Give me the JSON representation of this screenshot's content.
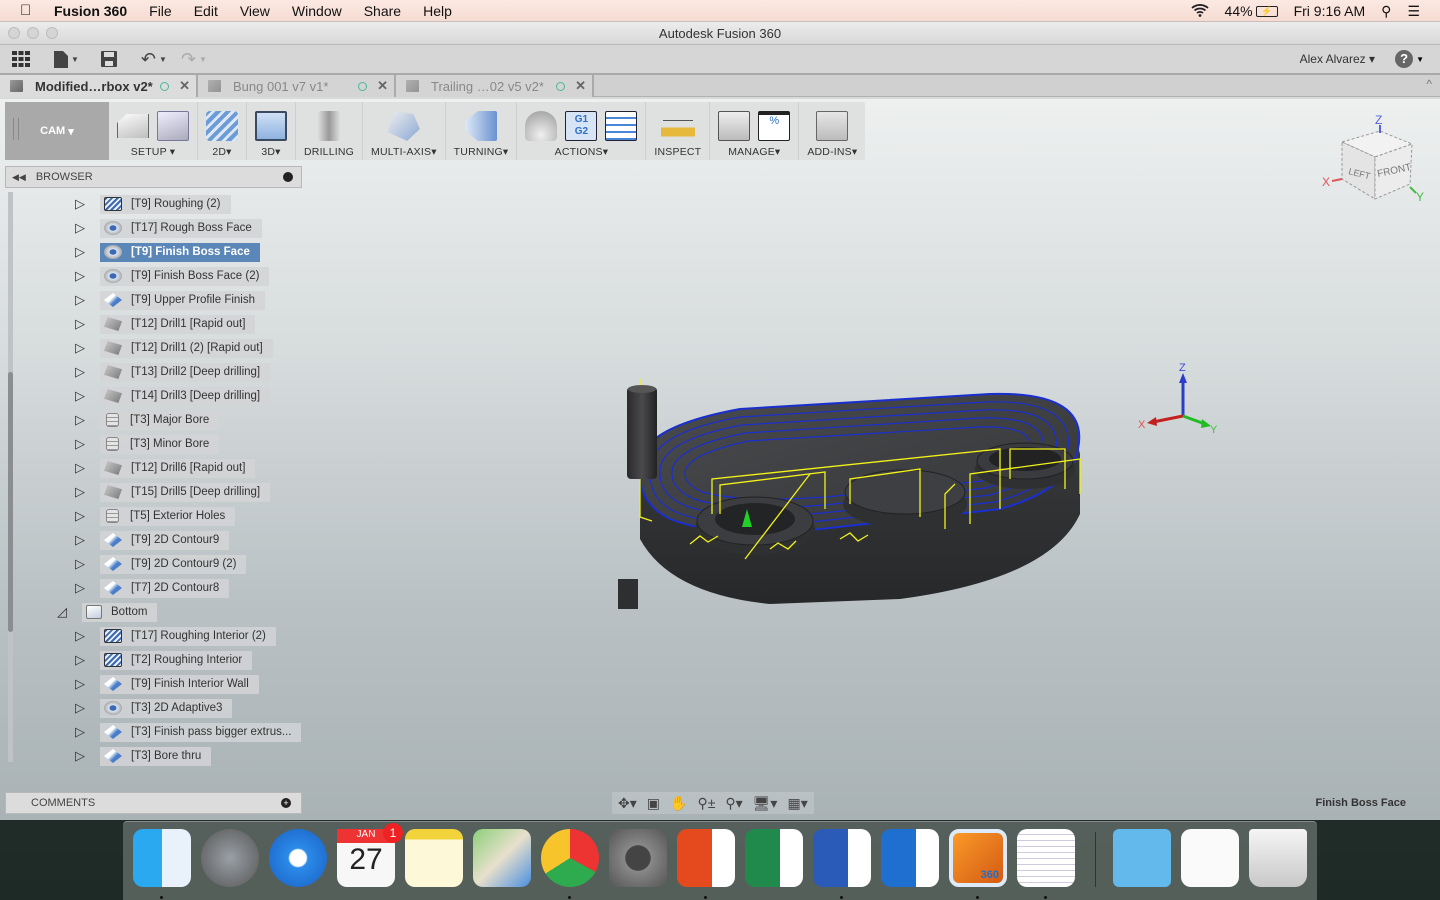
{
  "menubar": {
    "apple": "",
    "app": "Fusion 360",
    "items": [
      "File",
      "Edit",
      "View",
      "Window",
      "Share",
      "Help"
    ],
    "battery": "44%",
    "clock": "Fri 9:16 AM"
  },
  "window": {
    "title": "Autodesk Fusion 360"
  },
  "quick_access": {
    "user": "Alex Alvarez",
    "help": "?"
  },
  "doc_tabs": [
    {
      "name": "Modified…rbox v2*",
      "active": true
    },
    {
      "name": "Bung 001 v7 v1*",
      "active": false
    },
    {
      "name": "Trailing …02 v5 v2*",
      "active": false
    }
  ],
  "ribbon": {
    "workspace": "CAM",
    "groups": [
      {
        "label": "SETUP",
        "dropdown": true
      },
      {
        "label": "2D",
        "dropdown": true
      },
      {
        "label": "3D",
        "dropdown": true
      },
      {
        "label": "DRILLING",
        "dropdown": false
      },
      {
        "label": "MULTI-AXIS",
        "dropdown": true
      },
      {
        "label": "TURNING",
        "dropdown": true
      },
      {
        "label": "ACTIONS",
        "dropdown": true
      },
      {
        "label": "INSPECT",
        "dropdown": false
      },
      {
        "label": "MANAGE",
        "dropdown": true
      },
      {
        "label": "ADD-INS",
        "dropdown": true
      }
    ],
    "post_icon_text": "G1\nG2",
    "pct_icon_text": "%"
  },
  "browser": {
    "title": "BROWSER",
    "items": [
      {
        "label": "[T9] Roughing (2)",
        "icon": "rough"
      },
      {
        "label": "[T17] Rough Boss Face",
        "icon": "face"
      },
      {
        "label": "[T9] Finish Boss Face",
        "icon": "face",
        "selected": true
      },
      {
        "label": "[T9] Finish Boss Face (2)",
        "icon": "face"
      },
      {
        "label": "[T9] Upper Profile Finish",
        "icon": "contour"
      },
      {
        "label": "[T12] Drill1 [Rapid out]",
        "icon": "drill"
      },
      {
        "label": "[T12] Drill1 (2) [Rapid out]",
        "icon": "drill"
      },
      {
        "label": "[T13] Drill2 [Deep drilling]",
        "icon": "drill"
      },
      {
        "label": "[T14] Drill3 [Deep drilling]",
        "icon": "drill"
      },
      {
        "label": "[T3] Major Bore",
        "icon": "bore"
      },
      {
        "label": "[T3] Minor Bore",
        "icon": "bore"
      },
      {
        "label": "[T12] Drill6 [Rapid out]",
        "icon": "drill"
      },
      {
        "label": "[T15] Drill5 [Deep drilling]",
        "icon": "drill"
      },
      {
        "label": "[T5] Exterior Holes",
        "icon": "bore"
      },
      {
        "label": "[T9] 2D Contour9",
        "icon": "contour"
      },
      {
        "label": "[T9] 2D Contour9 (2)",
        "icon": "contour"
      },
      {
        "label": "[T7] 2D Contour8",
        "icon": "contour"
      }
    ],
    "setup": {
      "label": "Bottom"
    },
    "setup_items": [
      {
        "label": "[T17] Roughing Interior (2)",
        "icon": "rough"
      },
      {
        "label": "[T2] Roughing Interior",
        "icon": "rough"
      },
      {
        "label": "[T9] Finish Interior Wall",
        "icon": "contour"
      },
      {
        "label": "[T3] 2D Adaptive3",
        "icon": "face"
      },
      {
        "label": "[T3] Finish pass bigger extrus...",
        "icon": "contour"
      },
      {
        "label": "[T3] Bore thru",
        "icon": "contour"
      }
    ]
  },
  "comments": {
    "title": "COMMENTS"
  },
  "viewcube": {
    "left": "LEFT",
    "front": "FRONT",
    "x": "X",
    "y": "Y",
    "z": "Z"
  },
  "triad": {
    "x": "X",
    "y": "Y",
    "z": "Z"
  },
  "status": {
    "operation": "Finish Boss Face"
  },
  "dock": {
    "apps": [
      "Finder",
      "Launchpad",
      "Safari",
      "Calendar",
      "Notes",
      "Maps",
      "Chrome",
      "System Preferences",
      "PowerPoint",
      "Excel",
      "Word",
      "Outlook",
      "Fusion 360",
      "TextEdit",
      "Downloads",
      "Document",
      "Trash"
    ],
    "calendar_month": "JAN",
    "calendar_day": "27",
    "calendar_badge": "1",
    "fusion_label": "360"
  },
  "colors": {
    "selection": "#5a87b8",
    "toolpath_cut": "#1a2fd0",
    "toolpath_rapid": "#f2f21a",
    "part": "#3a3b3d"
  }
}
